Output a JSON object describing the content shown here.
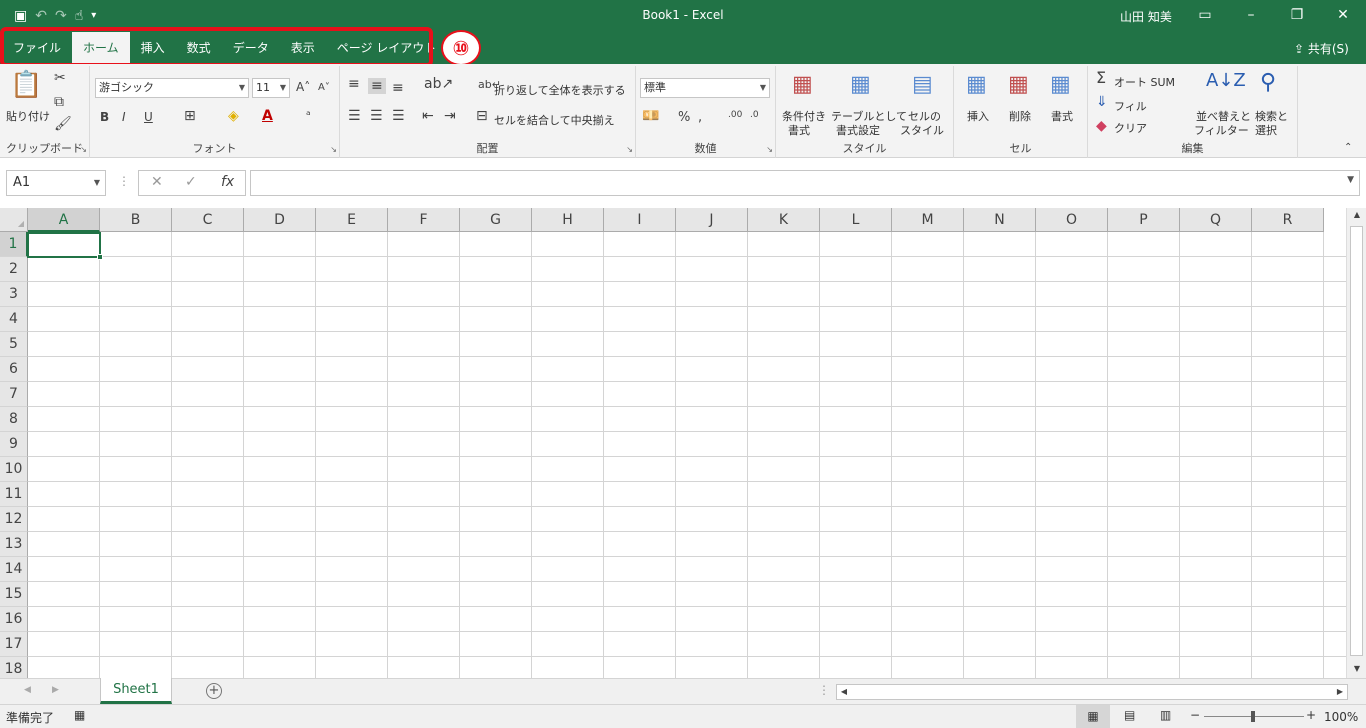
{
  "window": {
    "title": "Book1  -  Excel",
    "user": "山田 知美",
    "share_label": "共有(S)"
  },
  "annotation": {
    "marker": "⑩"
  },
  "tabs": [
    "ファイル",
    "ホーム",
    "挿入",
    "数式",
    "データ",
    "表示",
    "ページ レイアウト"
  ],
  "active_tab": "ホーム",
  "ribbon": {
    "clipboard": {
      "paste_label": "貼り付け",
      "group": "クリップボード"
    },
    "font": {
      "name": "游ゴシック",
      "size": "11",
      "bold": "B",
      "italic": "I",
      "underline": "U",
      "group": "フォント"
    },
    "alignment": {
      "wrap_text": "折り返して全体を表示する",
      "merge_center": "セルを結合して中央揃え",
      "group": "配置"
    },
    "number": {
      "format": "標準",
      "percent": "%",
      "group": "数値"
    },
    "styles": {
      "conditional_1": "条件付き",
      "conditional_2": "書式",
      "table_1": "テーブルとして",
      "table_2": "書式設定",
      "cell_1": "セルの",
      "cell_2": "スタイル",
      "group": "スタイル"
    },
    "cells": {
      "insert": "挿入",
      "delete": "削除",
      "format": "書式",
      "group": "セル"
    },
    "editing": {
      "autosum": "オート SUM",
      "fill": "フィル",
      "clear": "クリア",
      "sort_1": "並べ替えと",
      "sort_2": "フィルター",
      "find_1": "検索と",
      "find_2": "選択",
      "group": "編集"
    }
  },
  "formula_bar": {
    "name_box": "A1",
    "fx": "fx"
  },
  "columns": [
    "A",
    "B",
    "C",
    "D",
    "E",
    "F",
    "G",
    "H",
    "I",
    "J",
    "K",
    "L",
    "M",
    "N",
    "O",
    "P",
    "Q",
    "R"
  ],
  "rows": [
    "1",
    "2",
    "3",
    "4",
    "5",
    "6",
    "7",
    "8",
    "9",
    "10",
    "11",
    "12",
    "13",
    "14",
    "15",
    "16",
    "17",
    "18"
  ],
  "sheet_tab": "Sheet1",
  "status": {
    "ready": "準備完了",
    "zoom": "100%"
  },
  "colors": {
    "accent": "#217346",
    "highlight": "#e8101a"
  }
}
